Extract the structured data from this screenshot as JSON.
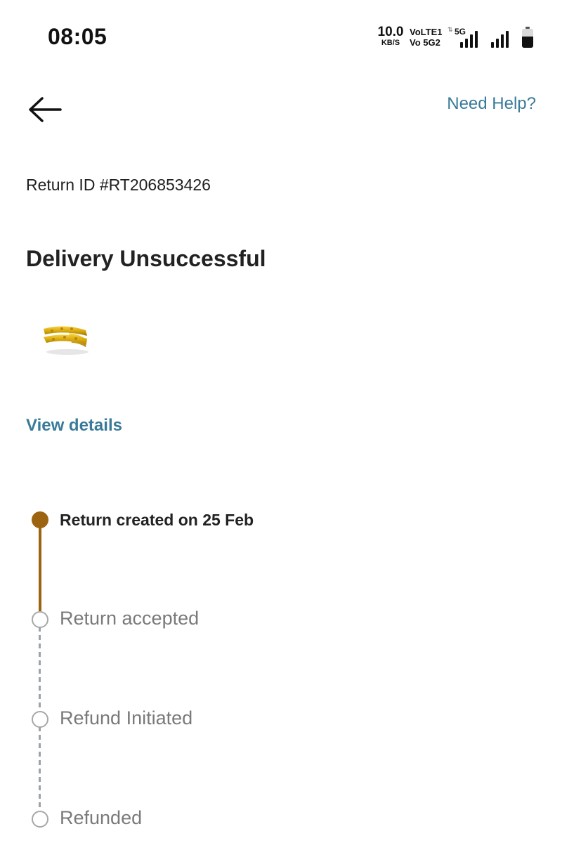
{
  "status_bar": {
    "time": "08:05",
    "net_speed": "10.0",
    "net_speed_unit": "KB/S",
    "volte_line1": "VoLTE1",
    "volte_line2": "Vo 5G2",
    "network_type": "5G",
    "battery_level": 0.6
  },
  "header": {
    "back_icon": "arrow-left-icon",
    "help_label": "Need Help?"
  },
  "return": {
    "id_text": "Return ID #RT206853426",
    "status_title": "Delivery Unsuccessful",
    "product_image": "gold-ring-image",
    "view_details_label": "View details"
  },
  "timeline": {
    "steps": [
      {
        "label": "Return created on 25 Feb",
        "state": "done"
      },
      {
        "label": "Return accepted",
        "state": "pending"
      },
      {
        "label": "Refund Initiated",
        "state": "pending"
      },
      {
        "label": "Refunded",
        "state": "pending"
      }
    ]
  },
  "colors": {
    "accent_link": "#3a7a99",
    "timeline_done": "#9c6410",
    "timeline_pending": "#a7a7a7",
    "timeline_dashed": "#9aa3ab"
  }
}
